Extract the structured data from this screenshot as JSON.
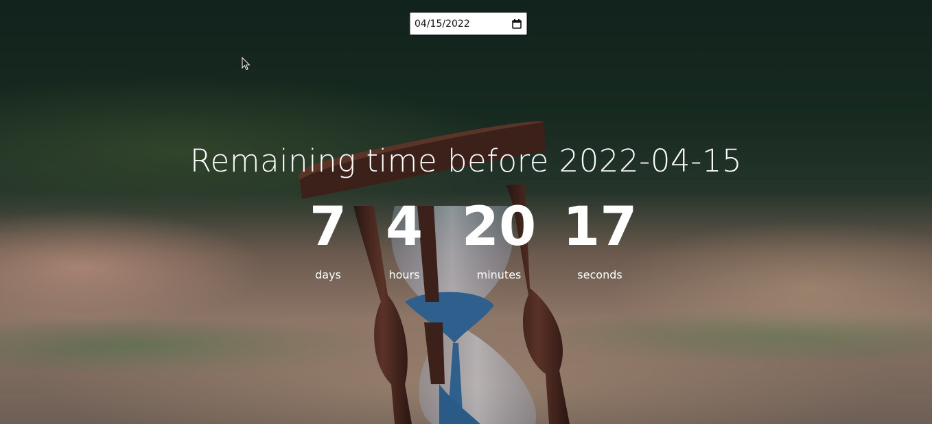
{
  "date_input": {
    "value": "04/15/2022",
    "icon": "calendar-icon"
  },
  "title": "Remaining time before 2022-04-15",
  "countdown": {
    "days": {
      "value": "7",
      "label": "days"
    },
    "hours": {
      "value": "4",
      "label": "hours"
    },
    "minutes": {
      "value": "20",
      "label": "minutes"
    },
    "seconds": {
      "value": "17",
      "label": "seconds"
    }
  },
  "cursor_icon": "mouse-pointer-icon"
}
